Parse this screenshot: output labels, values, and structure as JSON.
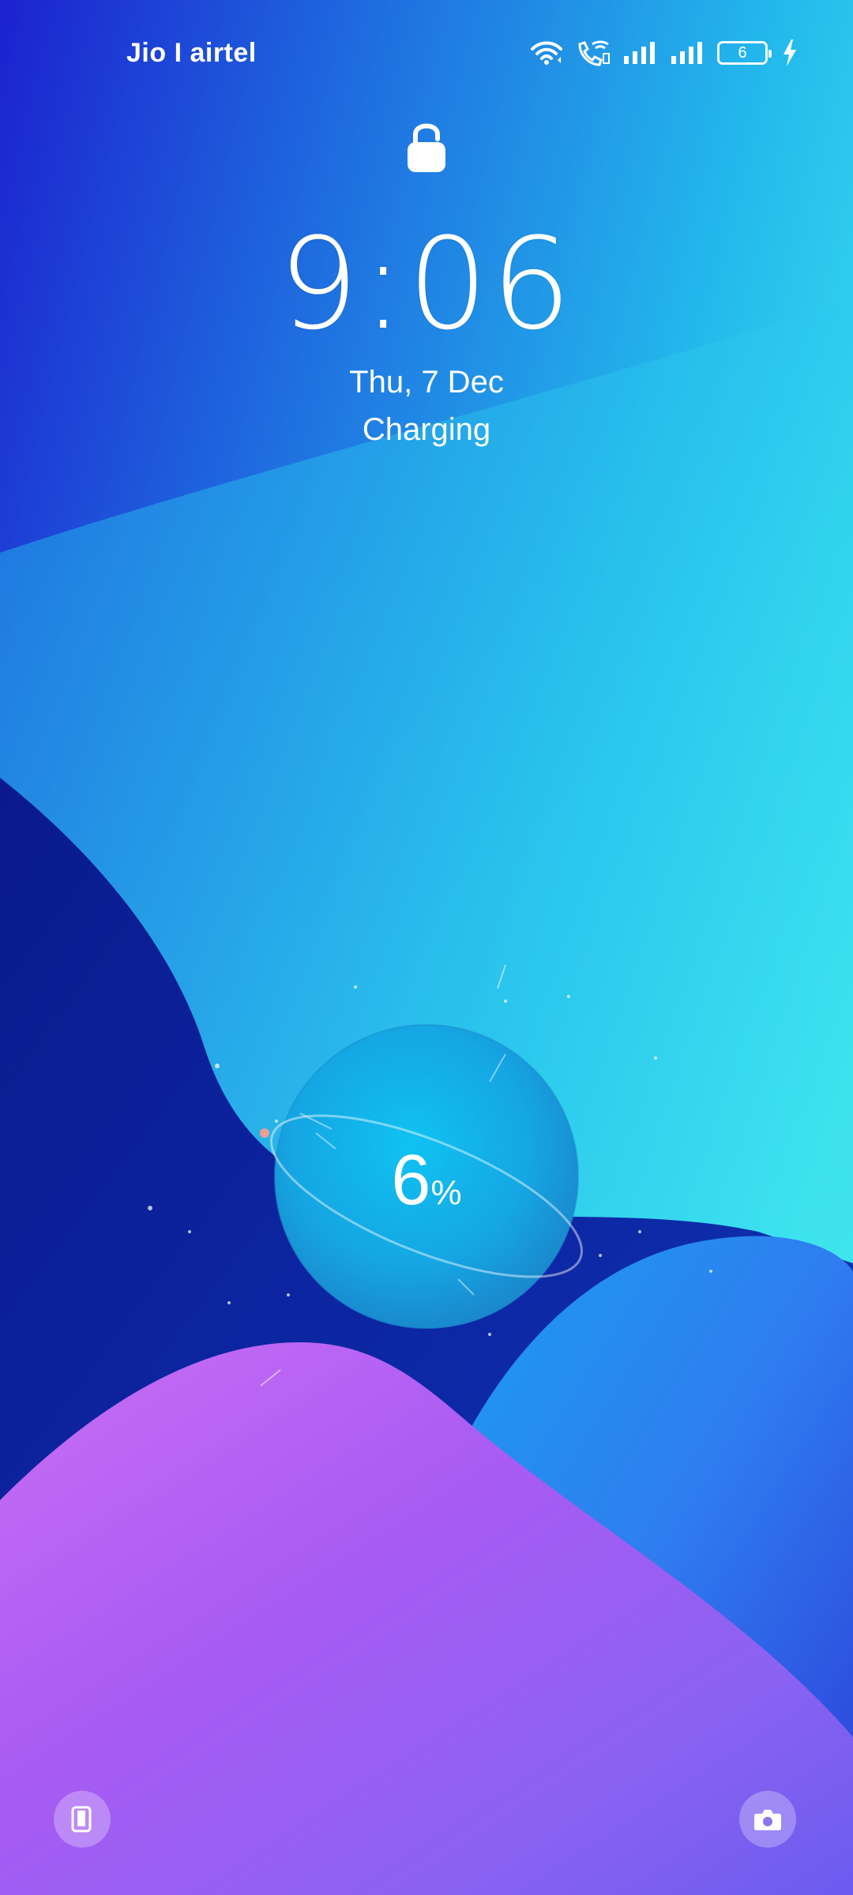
{
  "status_bar": {
    "carrier": "Jio I airtel",
    "battery_level": "6",
    "icons": [
      "wifi-icon",
      "wifi-calling-icon",
      "signal-icon",
      "signal-icon",
      "battery-icon",
      "charging-bolt-icon"
    ]
  },
  "lockscreen": {
    "lock_icon": "lock-icon",
    "time": "9:06",
    "date": "Thu, 7 Dec",
    "status": "Charging"
  },
  "charging_orb": {
    "value": "6",
    "unit": "%"
  },
  "shortcuts": {
    "left": "phone-icon",
    "right": "camera-icon"
  },
  "colors": {
    "sky_top_left": "#2230d8",
    "sky_top_right": "#3ee6ee",
    "wave_dark": "#0b1e96",
    "wave_purple": "#b45cf2",
    "orb": "#19b4e8"
  }
}
